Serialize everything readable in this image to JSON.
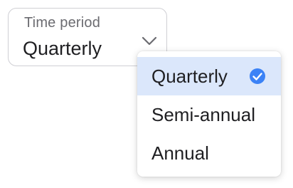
{
  "select": {
    "label": "Time period",
    "value": "Quarterly",
    "chevron_icon": "chevron-down-icon"
  },
  "dropdown": {
    "options": [
      {
        "label": "Quarterly",
        "selected": true
      },
      {
        "label": "Semi-annual",
        "selected": false
      },
      {
        "label": "Annual",
        "selected": false
      }
    ],
    "check_icon": "check-circle-icon"
  },
  "colors": {
    "accent": "#3b82f6",
    "selected_bg": "#dbe7fb",
    "border": "#cfcfd4",
    "label_text": "#6b6b70",
    "text": "#1f1f22"
  }
}
